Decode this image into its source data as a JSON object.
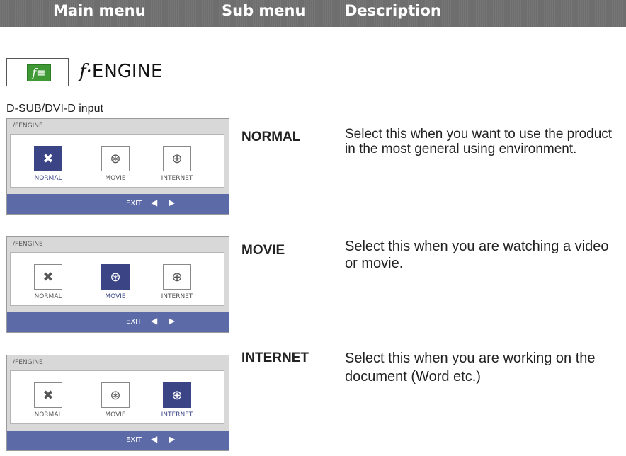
{
  "header": {
    "main_menu": "Main menu",
    "sub_menu": "Sub menu",
    "description": "Description"
  },
  "feature": {
    "icon_glyph": "f≡",
    "name_prefix": "f·",
    "name": "ENGINE"
  },
  "input_label": "D-SUB/DVI-D input",
  "osd": {
    "title": "/FENGINE",
    "options": [
      "NORMAL",
      "MOVIE",
      "INTERNET"
    ],
    "exit_label": "EXIT",
    "left_arrow": "◀",
    "right_arrow": "▶",
    "icons": {
      "normal": "✖",
      "movie": "⊛",
      "internet": "⊕"
    }
  },
  "rows": [
    {
      "submenu": "NORMAL",
      "selected": "NORMAL",
      "description": "Select this when you want to use the product in the most general using environment."
    },
    {
      "submenu": "MOVIE",
      "selected": "MOVIE",
      "description": "Select this when you are watching a video or movie."
    },
    {
      "submenu": "INTERNET",
      "selected": "INTERNET",
      "description": "Select this when you are working on the document (Word etc.)"
    }
  ]
}
